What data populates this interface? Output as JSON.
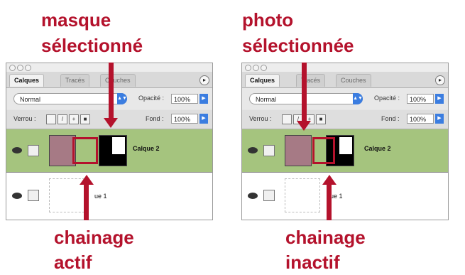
{
  "captions": {
    "left_top_line1": "masque",
    "left_top_line2": "sélectionné",
    "right_top_line1": "photo",
    "right_top_line2": "sélectionnée",
    "left_bottom_line1": "chainage",
    "left_bottom_line2": "actif",
    "right_bottom_line1": "chainage",
    "right_bottom_line2": "inactif"
  },
  "panels": [
    {
      "tabs": [
        "Calques",
        "Tracés",
        "Couches"
      ],
      "blend_mode": "Normal",
      "opacity_label": "Opacité :",
      "opacity_value": "100%",
      "lock_label": "Verrou :",
      "fill_label": "Fond :",
      "fill_value": "100%",
      "layer_top_name": "Calque 2",
      "layer_bottom_name": "ue 1"
    },
    {
      "tabs": [
        "Calques",
        "Tracés",
        "Couches"
      ],
      "blend_mode": "Normal",
      "opacity_label": "Opacité :",
      "opacity_value": "100%",
      "lock_label": "Verrou :",
      "fill_label": "Fond :",
      "fill_value": "100%",
      "layer_top_name": "Calque 2",
      "layer_bottom_name": "ue 1"
    }
  ],
  "colors": {
    "accent_red": "#b4122c",
    "selected_layer_green": "#a5c47e"
  }
}
